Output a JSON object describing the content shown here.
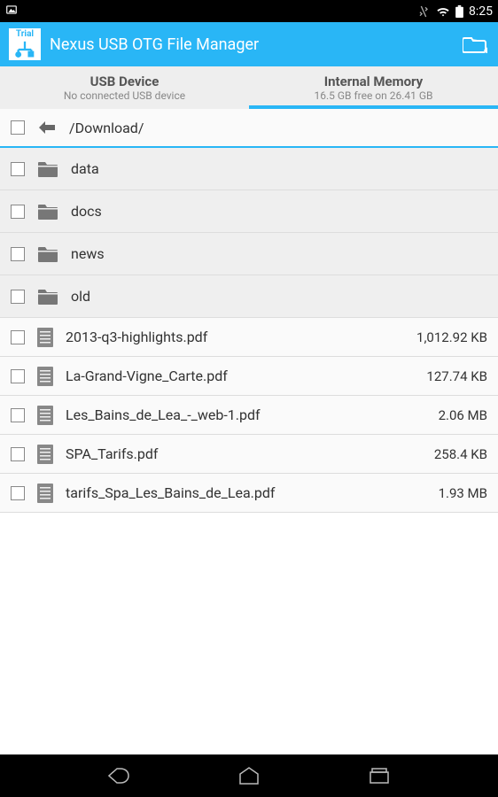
{
  "status": {
    "time": "8:25"
  },
  "app": {
    "logo_text": "Trial",
    "title": "Nexus USB OTG File Manager"
  },
  "tabs": {
    "usb": {
      "title": "USB Device",
      "sub": "No connected USB device"
    },
    "internal": {
      "title": "Internal Memory",
      "sub": "16.5 GB free on 26.41 GB"
    }
  },
  "path": "/Download/",
  "items": [
    {
      "name": "data",
      "type": "folder",
      "size": ""
    },
    {
      "name": "docs",
      "type": "folder",
      "size": ""
    },
    {
      "name": "news",
      "type": "folder",
      "size": ""
    },
    {
      "name": "old",
      "type": "folder",
      "size": ""
    },
    {
      "name": "2013-q3-highlights.pdf",
      "type": "file",
      "size": "1,012.92 KB"
    },
    {
      "name": "La-Grand-Vigne_Carte.pdf",
      "type": "file",
      "size": "127.74 KB"
    },
    {
      "name": "Les_Bains_de_Lea_-_web-1.pdf",
      "type": "file",
      "size": "2.06 MB"
    },
    {
      "name": "SPA_Tarifs.pdf",
      "type": "file",
      "size": "258.4 KB"
    },
    {
      "name": "tarifs_Spa_Les_Bains_de_Lea.pdf",
      "type": "file",
      "size": "1.93 MB"
    }
  ]
}
